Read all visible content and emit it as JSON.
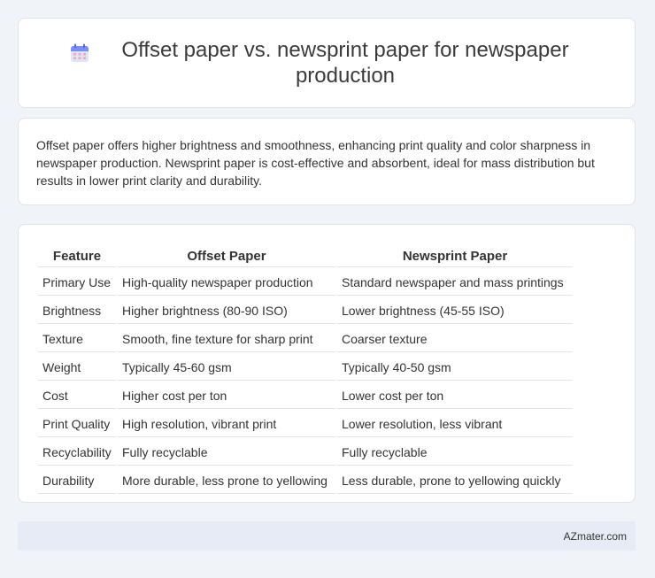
{
  "header": {
    "title": "Offset paper vs. newsprint paper for newspaper production",
    "icon": "calendar-icon"
  },
  "summary": {
    "text": "Offset paper offers higher brightness and smoothness, enhancing print quality and color sharpness in newspaper production. Newsprint paper is cost-effective and absorbent, ideal for mass distribution but results in lower print clarity and durability."
  },
  "table": {
    "headers": [
      "Feature",
      "Offset Paper",
      "Newsprint Paper"
    ],
    "rows": [
      [
        "Primary Use",
        "High-quality newspaper production",
        "Standard newspaper and mass printings"
      ],
      [
        "Brightness",
        "Higher brightness (80-90 ISO)",
        "Lower brightness (45-55 ISO)"
      ],
      [
        "Texture",
        "Smooth, fine texture for sharp print",
        "Coarser texture"
      ],
      [
        "Weight",
        "Typically 45-60 gsm",
        "Typically 40-50 gsm"
      ],
      [
        "Cost",
        "Higher cost per ton",
        "Lower cost per ton"
      ],
      [
        "Print Quality",
        "High resolution, vibrant print",
        "Lower resolution, less vibrant"
      ],
      [
        "Recyclability",
        "Fully recyclable",
        "Fully recyclable"
      ],
      [
        "Durability",
        "More durable, less prone to yellowing",
        "Less durable, prone to yellowing quickly"
      ]
    ]
  },
  "footer": {
    "site": "AZmater.com"
  },
  "colors": {
    "background": "#f0f3f8",
    "footer_bg": "#e6ebf6",
    "icon_accent": "#7b8cff"
  }
}
